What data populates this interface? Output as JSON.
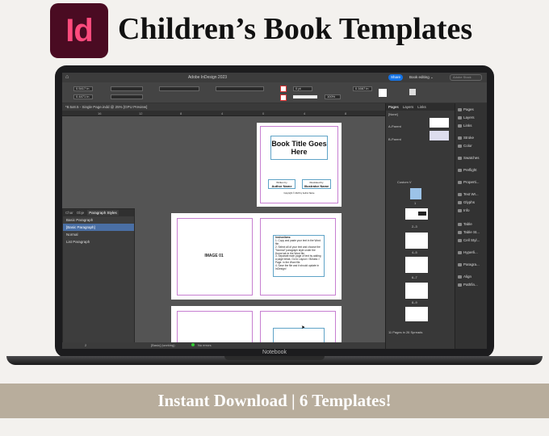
{
  "header": {
    "logo_text": "Id",
    "headline": "Children’s Book Templates"
  },
  "banner": {
    "text": "Instant Download | 6 Templates!"
  },
  "laptop": {
    "brand": "Notebook"
  },
  "app": {
    "window_title": "Adobe InDesign 2023",
    "share_label": "Share",
    "workspace_label": "Book editing ⌄",
    "stock_search_placeholder": "Adobe Stock",
    "doc_tab": "*8.5x8.5 - Single Page.indd @ 25% [GPU Preview]",
    "control_fields": [
      "0.5417 in",
      "0.4471 in",
      "0.1667 in",
      "100%",
      "0 pt"
    ],
    "ruler_ticks": [
      "16",
      "12",
      "8",
      "4",
      "0",
      "4",
      "8"
    ],
    "status": {
      "page": "2",
      "style": "[Basic] (working)",
      "errors": "No errors"
    }
  },
  "paragraph_styles": {
    "tabs": [
      "Char",
      "Obje",
      "Paragraph Styles"
    ],
    "items": [
      "Basic Paragraph",
      "[Basic Paragraph]",
      "Normal",
      "List Paragraph"
    ]
  },
  "pages_panel": {
    "tabs": [
      "Pages",
      "Layers",
      "Links"
    ],
    "masters": [
      "[None]",
      "A-Parent",
      "B-Parent"
    ],
    "size_label": "Custom V",
    "spread_labels": [
      "1",
      "2–3",
      "4–5",
      "6–7",
      "8–9"
    ],
    "footer": "11 Pages in 26 Spreads"
  },
  "side_panels": [
    "Pages",
    "Layers",
    "Links",
    "Stroke",
    "Color",
    "Swatches",
    "Preflight",
    "Properti...",
    "Text Wr...",
    "Glyphs",
    "Info",
    "Table",
    "Table St...",
    "Cell Styl...",
    "Hyperli...",
    "Paragra...",
    "Align",
    "Pathfin..."
  ],
  "canvas": {
    "cover_title": "Book Title Goes Here",
    "author_caption": "Written by",
    "author_name": "Author Name",
    "illustrator_caption": "Illustrated by",
    "illustrator_name": "Illustrator Name",
    "copyright_line": "Copyright © 2023 by Author Name",
    "image_label": "IMAGE 01",
    "instructions_title": "Instructions:",
    "instructions": [
      "1.    Copy and paste your text in the Word file.",
      "2.    Select all of your text and choose the \"Normal\" paragraph style under the Home tab in the Word file.",
      "3.    Separate each page of text by adding a page break. Go to Layout > Breaks > Page. in the Word file.",
      "4.    Save the file and it should update in InDesign!"
    ]
  },
  "colors": {
    "indesign": "#ff3366",
    "indesign_bg": "#4a0b22",
    "banner": "#b8ad9c",
    "selection": "#4a6fa5",
    "share": "#1473e6"
  }
}
